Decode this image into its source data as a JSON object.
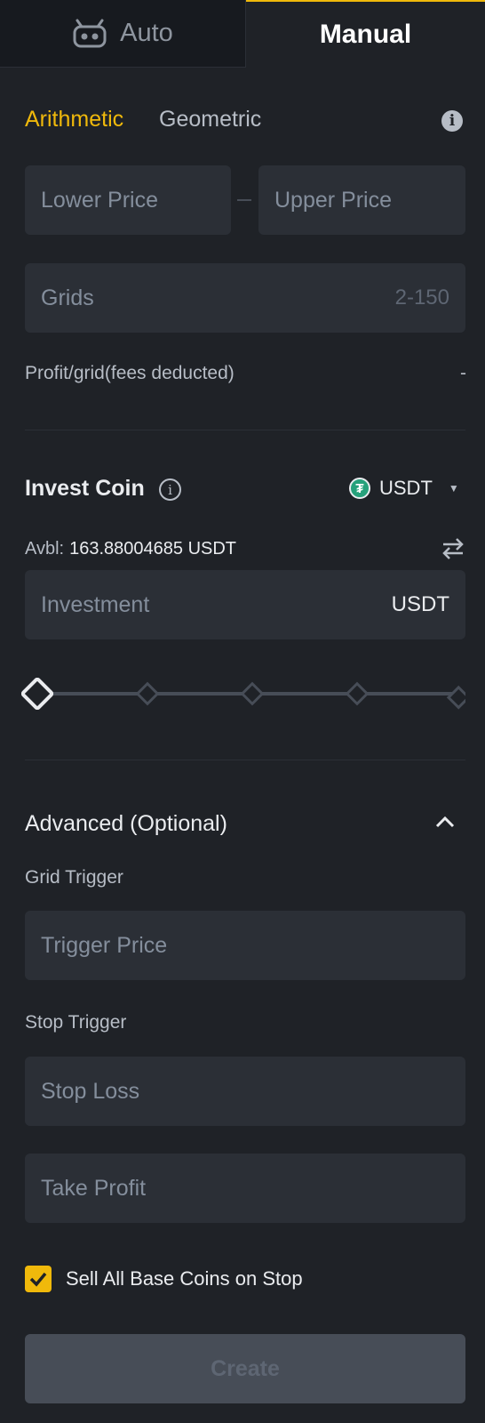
{
  "tabs": {
    "auto_label": "Auto",
    "manual_label": "Manual"
  },
  "modes": {
    "arithmetic": "Arithmetic",
    "geometric": "Geometric"
  },
  "price_range": {
    "lower_placeholder": "Lower Price",
    "upper_placeholder": "Upper Price"
  },
  "grids": {
    "placeholder": "Grids",
    "range": "2-150"
  },
  "profit": {
    "label": "Profit/grid(fees deducted)",
    "value": "-"
  },
  "invest": {
    "title": "Invest Coin",
    "coin": "USDT",
    "coin_icon": "tether-icon",
    "avbl_label": "Avbl:",
    "avbl_value": "163.88004685 USDT",
    "investment_placeholder": "Investment",
    "investment_unit": "USDT",
    "slider_percent": 0
  },
  "advanced": {
    "title": "Advanced (Optional)",
    "grid_trigger_label": "Grid Trigger",
    "trigger_price_placeholder": "Trigger Price",
    "stop_trigger_label": "Stop Trigger",
    "stop_loss_placeholder": "Stop Loss",
    "take_profit_placeholder": "Take Profit",
    "sell_all_label": "Sell All Base Coins on Stop",
    "sell_all_checked": true
  },
  "create_label": "Create",
  "colors": {
    "accent": "#f0b90b",
    "background": "#1f2227",
    "field": "#2b2f36",
    "tether": "#26a17b"
  }
}
